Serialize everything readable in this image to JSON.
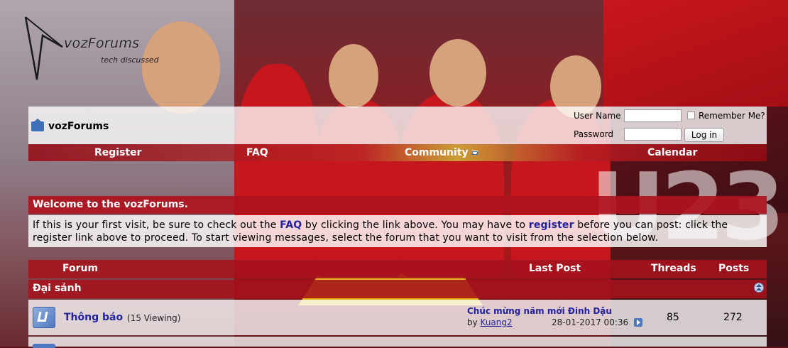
{
  "logo": {
    "name": "vozForums",
    "tagline": "tech discussed"
  },
  "header": {
    "site_title": "vozForums",
    "login": {
      "username_label": "User Name",
      "username_value": "",
      "password_label": "Password",
      "password_value": "",
      "remember_label": "Remember Me?",
      "login_button": "Log in"
    }
  },
  "nav": {
    "items": [
      {
        "label": "Register"
      },
      {
        "label": "FAQ"
      },
      {
        "label": "Community"
      },
      {
        "label": "Calendar"
      }
    ]
  },
  "welcome": {
    "title": "Welcome to the vozForums.",
    "text_1": "If this is your first visit, be sure to check out the ",
    "link_faq": "FAQ",
    "text_2": " by clicking the link above. You may have to ",
    "link_register": "register",
    "text_3": " before you can post: click the register link above to proceed. To start viewing messages, select the forum that you want to visit from the selection below."
  },
  "table": {
    "headers": {
      "forum": "Forum",
      "last_post": "Last Post",
      "threads": "Threads",
      "posts": "Posts"
    },
    "category": {
      "name": "Đại sảnh"
    },
    "rows": [
      {
        "name": "Thông báo",
        "viewing": "(15 Viewing)",
        "last_post_title": "Chúc mừng năm mới Đinh Dậu",
        "by_label": "by",
        "last_post_user": "Kuang2",
        "last_post_date": "28-01-2017 00:36",
        "threads": "85",
        "posts": "272"
      }
    ]
  }
}
